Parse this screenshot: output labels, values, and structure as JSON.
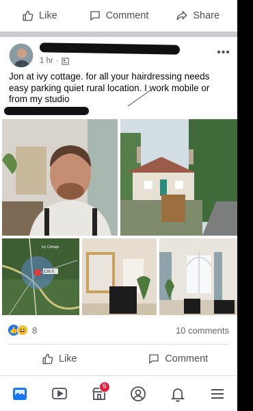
{
  "top_actions": {
    "like": "Like",
    "comment": "Comment",
    "share": "Share"
  },
  "post": {
    "time": "1 hr",
    "text": "Jon at ivy cottage. for all your hairdressing needs easy parking quiet rural location. I work mobile or from my studio",
    "photos": [
      {
        "icon": "man-portrait-photo"
      },
      {
        "icon": "cottage-photo"
      },
      {
        "icon": "map-photo"
      },
      {
        "icon": "studio-interior-photo"
      },
      {
        "icon": "window-room-photo"
      }
    ],
    "map_labels": {
      "pin": "Ivy Cottage",
      "scale": "£38.5"
    }
  },
  "reactions": {
    "count": "8",
    "comments": "10 comments"
  },
  "bottom_actions": {
    "like": "Like",
    "comment": "Comment"
  },
  "nav": {
    "notifications_badge": "9"
  },
  "colors": {
    "blue": "#1877f2",
    "badge": "#e41e3f"
  }
}
